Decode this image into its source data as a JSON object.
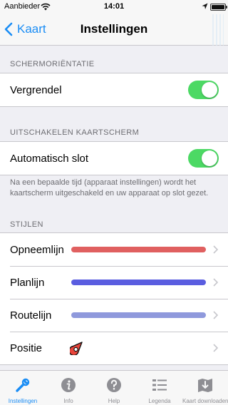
{
  "status_bar": {
    "carrier": "Aanbieder",
    "time": "14:01"
  },
  "nav": {
    "back_label": "Kaart",
    "title": "Instellingen"
  },
  "sections": {
    "orientation": {
      "header": "SCHERMORIËNTATIE",
      "row_label": "Vergrendel",
      "toggle_on": true
    },
    "auto_lock": {
      "header": "UITSCHAKELEN KAARTSCHERM",
      "row_label": "Automatisch slot",
      "toggle_on": true,
      "footer": "Na een bepaalde tijd (apparaat instellingen) wordt het kaartscherm uitgeschakeld en uw apparaat op slot gezet."
    },
    "styles": {
      "header": "STIJLEN",
      "rows": [
        {
          "label": "Opneemlijn",
          "color": "#e06060"
        },
        {
          "label": "Planlijn",
          "color": "#5a5de0"
        },
        {
          "label": "Routelijn",
          "color": "#8f99dc"
        },
        {
          "label": "Positie",
          "icon": "position-marker-icon"
        }
      ]
    }
  },
  "tabs": [
    {
      "label": "Instellingen",
      "icon": "wrench-icon",
      "active": true
    },
    {
      "label": "Info",
      "icon": "info-icon",
      "active": false
    },
    {
      "label": "Help",
      "icon": "help-icon",
      "active": false
    },
    {
      "label": "Legenda",
      "icon": "legend-list-icon",
      "active": false
    },
    {
      "label": "Kaart downloaden",
      "icon": "download-map-icon",
      "active": false
    }
  ],
  "colors": {
    "accent": "#1a8df5",
    "toggle_on": "#4cd964"
  }
}
